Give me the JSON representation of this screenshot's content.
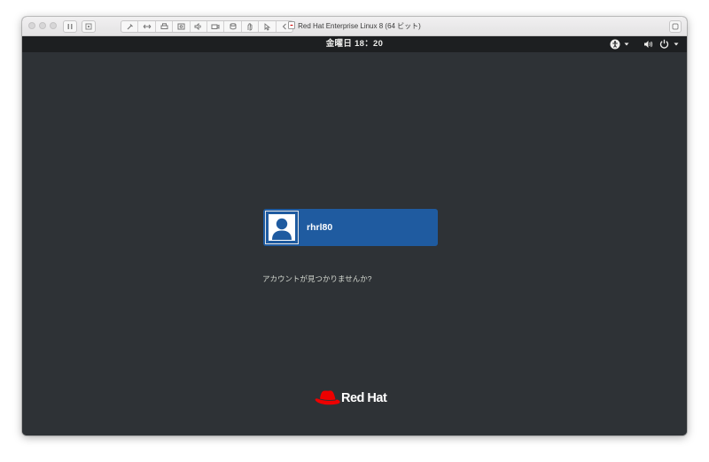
{
  "window": {
    "title": "Red Hat Enterprise Linux 8 (64 ビット)"
  },
  "toolbar": {
    "icons": [
      "wrench-icon",
      "arrows-icon",
      "printer-icon",
      "disk-icon",
      "speaker-icon",
      "camera-icon",
      "stack-icon",
      "hand-icon",
      "pointer-icon",
      "chevron-left-icon"
    ]
  },
  "gnome": {
    "clock": "金曜日 18：20",
    "user": {
      "name": "rhrl80"
    },
    "not_listed_text": "アカウントが見つかりませんか?",
    "logo_text": "Red Hat"
  },
  "colors": {
    "screen_bg": "#2e3236",
    "topbar_bg": "#1d1f21",
    "selected_user_bg": "#1f5ba0",
    "redhat_red": "#ee0000"
  }
}
